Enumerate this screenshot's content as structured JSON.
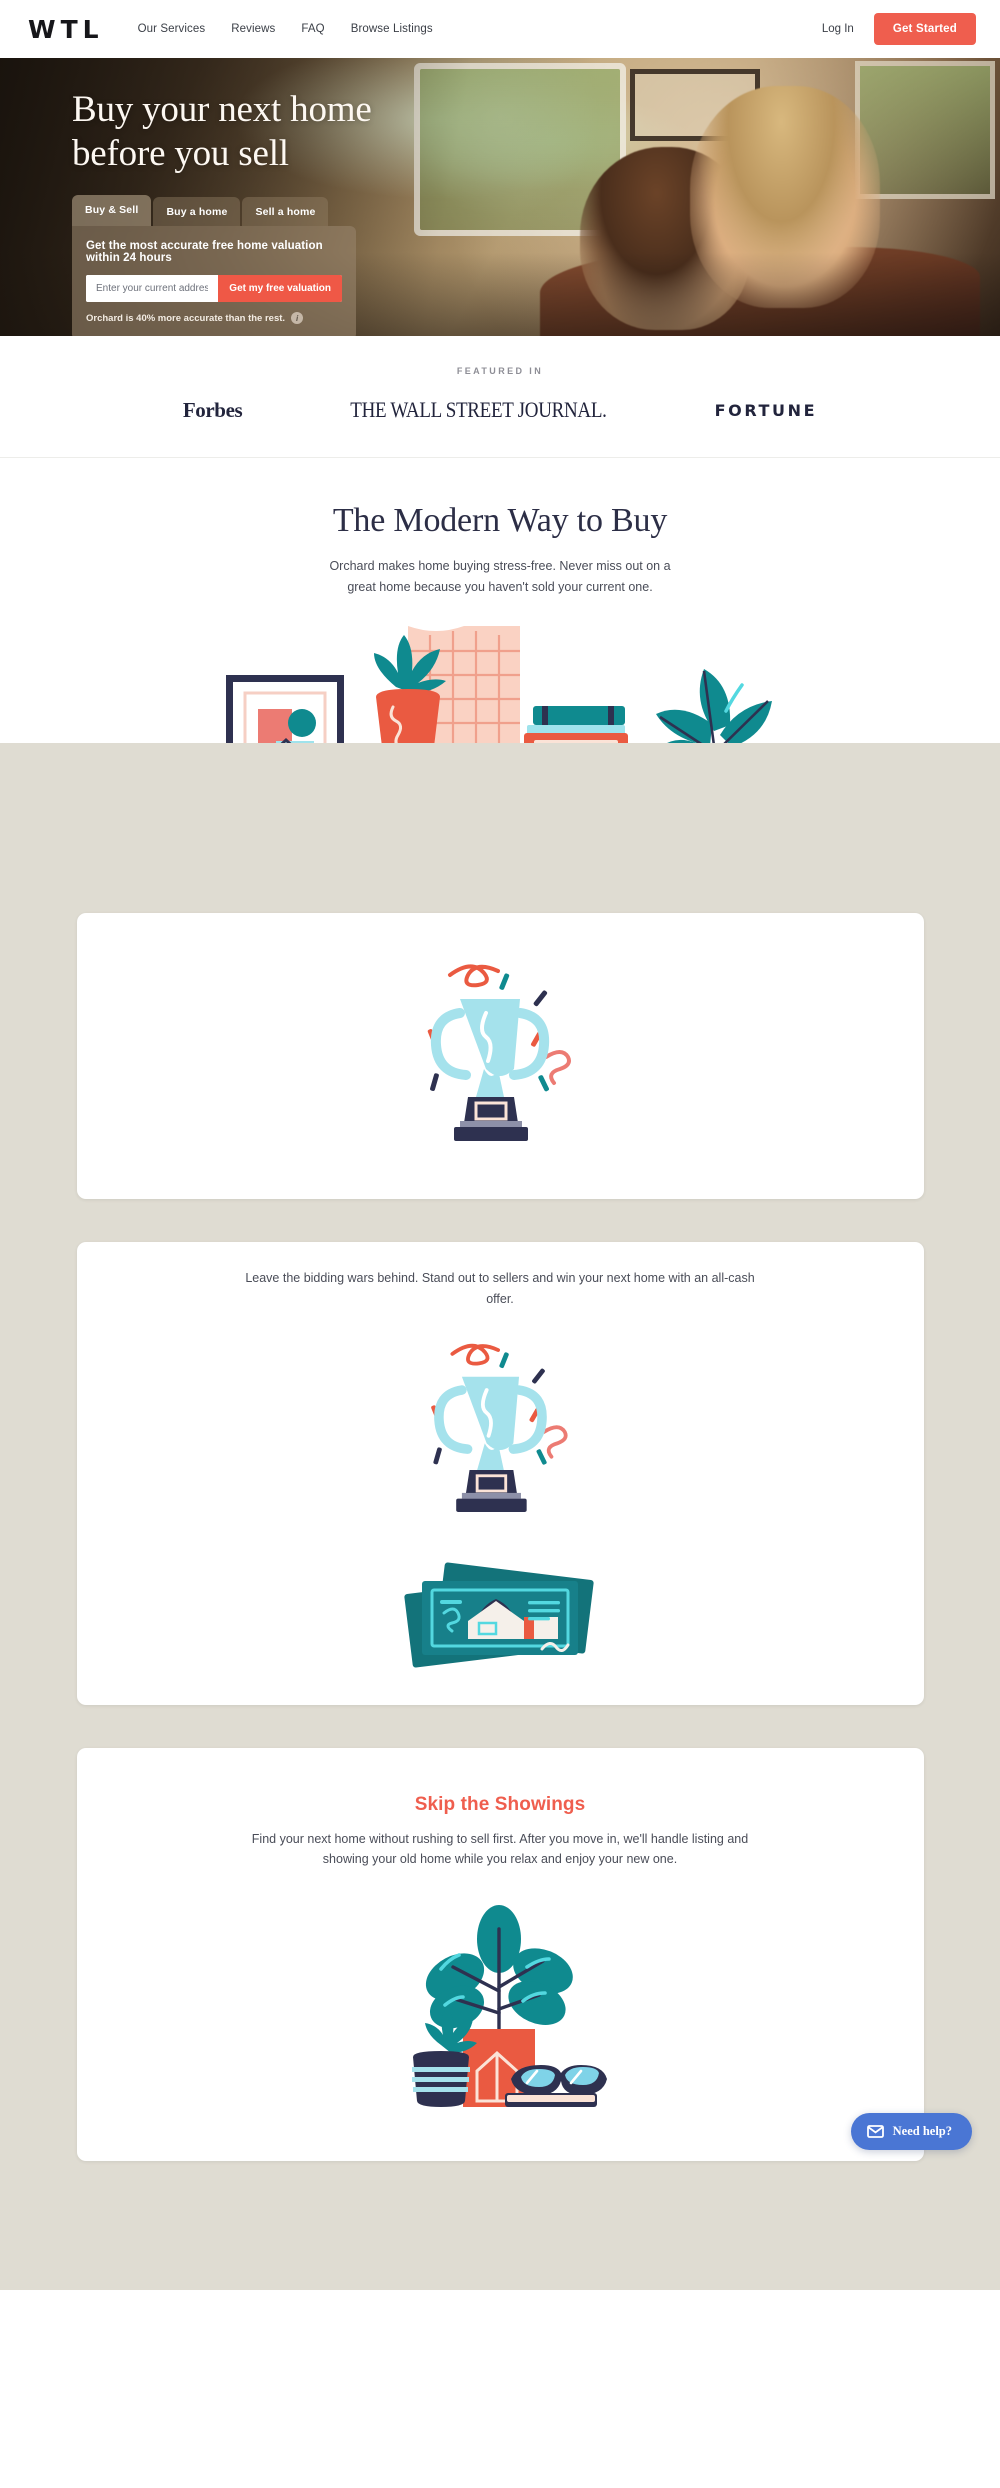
{
  "header": {
    "logo": "WTL",
    "nav": [
      {
        "label": "Our Services"
      },
      {
        "label": "Reviews"
      },
      {
        "label": "FAQ"
      },
      {
        "label": "Browse Listings"
      }
    ],
    "login_label": "Log In",
    "cta_label": "Get Started",
    "accent_color": "#ef5e4e"
  },
  "hero": {
    "title_line1": "Buy your next home",
    "title_line2": "before you sell",
    "tabs": [
      {
        "label": "Buy & Sell",
        "active": true
      },
      {
        "label": "Buy a home",
        "active": false
      },
      {
        "label": "Sell a home",
        "active": false
      }
    ],
    "card_title": "Get the most accurate free home valuation within 24 hours",
    "input_placeholder": "Enter your current address...",
    "input_value": "",
    "submit_label": "Get my free valuation",
    "note": "Orchard is 40% more accurate than the rest.",
    "info_glyph": "i"
  },
  "featured": {
    "label": "FEATURED IN",
    "logos": [
      {
        "name": "Forbes"
      },
      {
        "name": "THE WALL STREET JOURNAL."
      },
      {
        "name": "FORTUNE"
      }
    ]
  },
  "modern": {
    "heading": "The Modern Way to Buy",
    "subheading": "Orchard makes home buying stress-free. Never miss out on a great home because you haven't sold your current one."
  },
  "cards": [
    {
      "heading": "",
      "body": "",
      "art": "trophy-illustration"
    },
    {
      "heading": "",
      "body": "Leave the bidding wars behind. Stand out to sellers and win your next home with an all-cash offer.",
      "art": "trophy-and-cash-illustration"
    },
    {
      "heading": "Skip the Showings",
      "body": "Find your next home without rushing to sell first. After you move in, we'll handle listing and showing your old home while you relax and enjoy your new one.",
      "art": "plant-books-glasses-illustration"
    }
  ],
  "chat": {
    "label": "Need help?",
    "icon": "envelope-icon",
    "color": "#4a76d4"
  },
  "colors": {
    "accent": "#ef5e4e",
    "beige": "#dfdcd2",
    "navy": "#2c2e46",
    "teal": "#0f8a8f",
    "light_blue": "#a5e2ec"
  }
}
